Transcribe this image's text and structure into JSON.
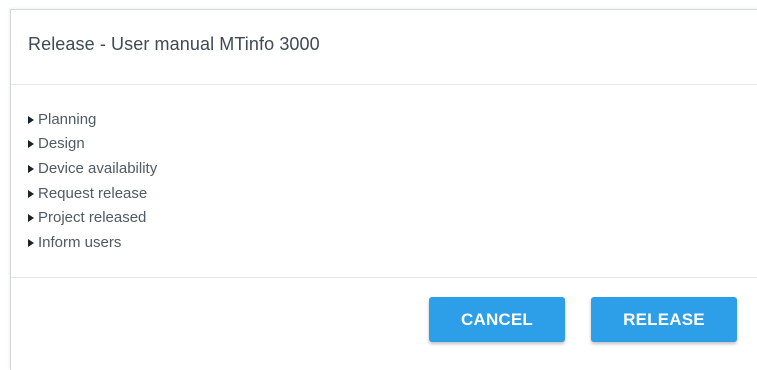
{
  "dialog": {
    "title": "Release - User manual MTinfo 3000",
    "steps": [
      {
        "label": "Planning",
        "icon": "caret-right-icon"
      },
      {
        "label": "Design",
        "icon": "caret-right-icon"
      },
      {
        "label": "Device availability",
        "icon": "caret-right-icon"
      },
      {
        "label": "Request release",
        "icon": "caret-right-icon"
      },
      {
        "label": "Project released",
        "icon": "caret-right-icon"
      },
      {
        "label": "Inform users",
        "icon": "caret-right-icon"
      }
    ],
    "buttons": {
      "cancel_label": "CANCEL",
      "release_label": "RELEASE"
    }
  },
  "colors": {
    "button_bg": "#2d9ee8",
    "button_text": "#ffffff",
    "title_text": "#3f4a55",
    "step_text": "#4e5a65"
  }
}
